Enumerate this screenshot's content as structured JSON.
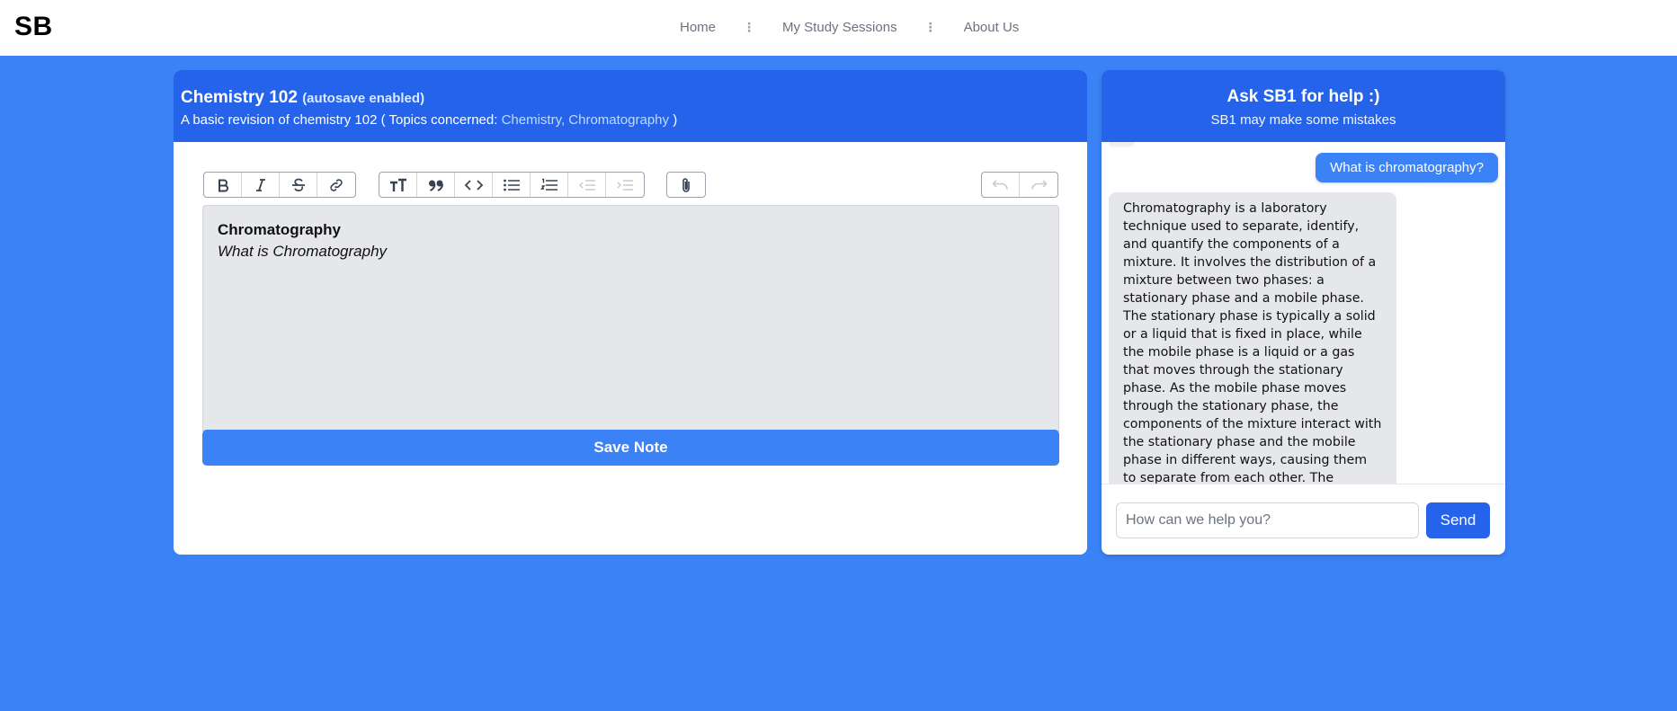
{
  "nav": {
    "logo": "SB",
    "links": [
      "Home",
      "My Study Sessions",
      "About Us"
    ]
  },
  "editor": {
    "title": "Chemistry 102",
    "autosave": "(autosave enabled)",
    "description_prefix": "A basic revision of chemistry 102 ( Topics concerned:",
    "topics": "Chemistry, Chromatography",
    "description_suffix": ")",
    "toolbar_groups": [
      [
        "bold-icon",
        "italic-icon",
        "strikethrough-icon",
        "link-icon"
      ],
      [
        "heading-icon",
        "quote-icon",
        "code-icon",
        "bullet-list-icon",
        "numbered-list-icon",
        "outdent-icon",
        "indent-icon"
      ],
      [
        "attach-icon"
      ],
      [
        "undo-icon",
        "redo-icon"
      ]
    ],
    "content_heading": "Chromatography",
    "content_line": "What is Chromatography",
    "save_label": "Save Note"
  },
  "chat": {
    "title": "Ask SB1 for help :)",
    "subtitle": "SB1 may make some mistakes",
    "user_message": "What is chromatography?",
    "bot_message": "Chromatography is a laboratory technique used to separate, identify, and quantify the components of a mixture. It involves the distribution of a mixture between two phases: a stationary phase and a mobile phase. The stationary phase is typically a solid or a liquid that is fixed in place, while the mobile phase is a liquid or a gas that moves through the stationary phase. As the mobile phase moves through the stationary phase, the components of the mixture interact with the stationary phase and the mobile phase in different ways, causing them to separate from each other. The separated components can then be detected and analyzed using various",
    "input_placeholder": "How can we help you?",
    "send_label": "Send"
  },
  "colors": {
    "page_bg": "#3b82f6",
    "header_bg": "#2563eb",
    "button": "#3b82f6",
    "user_bubble": "#3b82f6",
    "bot_bubble": "#e5e7eb"
  }
}
